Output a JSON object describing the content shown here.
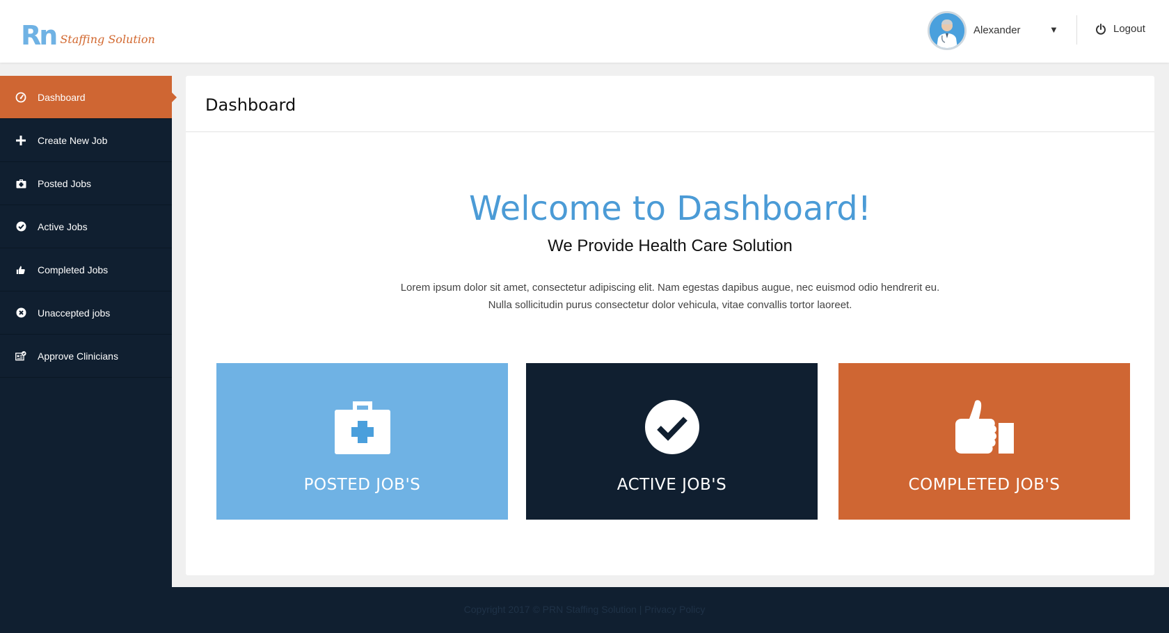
{
  "header": {
    "logo_mark": "Rn",
    "logo_text": "Staffing Solution",
    "user_name": "Alexander",
    "caret": "▼",
    "logout_label": "Logout"
  },
  "sidebar": {
    "items": [
      {
        "label": "Dashboard",
        "icon": "dashboard-gauge-icon",
        "active": true
      },
      {
        "label": "Create New Job",
        "icon": "plus-icon"
      },
      {
        "label": "Posted Jobs",
        "icon": "medical-kit-icon"
      },
      {
        "label": "Active Jobs",
        "icon": "check-circle-icon"
      },
      {
        "label": "Completed Jobs",
        "icon": "thumbs-up-icon"
      },
      {
        "label": "Unaccepted jobs",
        "icon": "x-circle-icon"
      },
      {
        "label": "Approve Clinicians",
        "icon": "approve-clinician-icon"
      }
    ]
  },
  "main": {
    "title": "Dashboard",
    "welcome": "Welcome to Dashboard!",
    "subtitle": "We Provide Health Care Solution",
    "description": "Lorem ipsum dolor sit amet, consectetur adipiscing elit. Nam egestas dapibus augue, nec euismod odio hendrerit eu. Nulla sollicitudin purus consectetur dolor vehicula, vitae convallis tortor laoreet.",
    "tiles": [
      {
        "label": "POSTED JOB'S",
        "icon": "medical-kit-icon",
        "color": "#6fb2e4"
      },
      {
        "label": "ACTIVE JOB'S",
        "icon": "check-circle-icon",
        "color": "#101f30"
      },
      {
        "label": "COMPLETED JOB'S",
        "icon": "thumbs-up-icon",
        "color": "#cf6633"
      }
    ]
  },
  "footer": {
    "text": "Copyright 2017 © PRN Staffing Solution | Privacy Policy"
  },
  "colors": {
    "accent_orange": "#cf6633",
    "accent_blue": "#6fb2e4",
    "navy": "#101f30"
  }
}
